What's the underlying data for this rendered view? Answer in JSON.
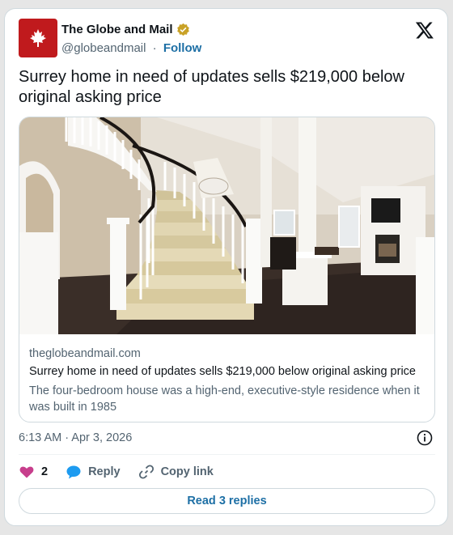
{
  "author": {
    "name": "The Globe and Mail",
    "handle": "@globeandmail",
    "separator": "·",
    "follow_label": "Follow",
    "verified_color": "#c9a227",
    "avatar_color": "#c01a1d",
    "avatar_icon": "maple-leaf-icon"
  },
  "brand_icon": "x-logo-icon",
  "tweet": {
    "text": "Surrey home in need of updates sells $219,000 below original asking price"
  },
  "link_card": {
    "image_alt": "Interior foyer with curved staircase",
    "domain": "theglobeandmail.com",
    "title": "Surrey home in need of updates sells $219,000 below original asking price",
    "description": "The four-bedroom house was a high-end, executive-style residence when it was built in 1985"
  },
  "meta": {
    "timestamp": "6:13 AM · Apr 3, 2026"
  },
  "actions": {
    "like_count": "2",
    "reply_label": "Reply",
    "copy_label": "Copy link"
  },
  "replies_button": "Read 3 replies",
  "colors": {
    "accent": "#1d6fa5",
    "like": "#c73e8c",
    "reply": "#1d9bf0",
    "muted": "#536471"
  }
}
